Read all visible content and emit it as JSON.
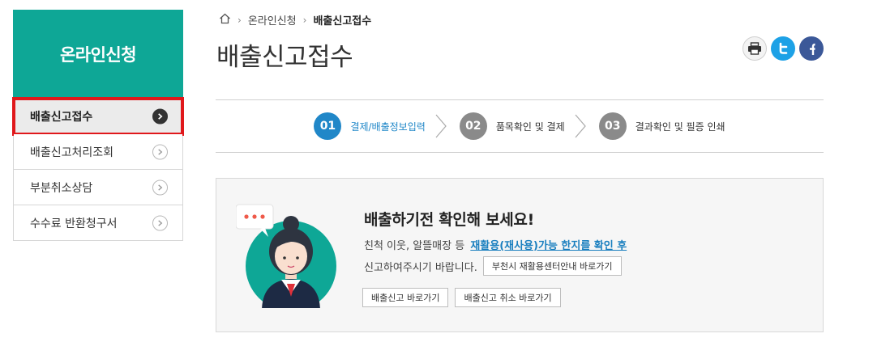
{
  "sidebar": {
    "title": "온라인신청",
    "items": [
      {
        "label": "배출신고접수",
        "active": true
      },
      {
        "label": "배출신고처리조회",
        "active": false
      },
      {
        "label": "부분취소상담",
        "active": false
      },
      {
        "label": "수수료 반환청구서",
        "active": false
      }
    ]
  },
  "breadcrumb": {
    "icon": "home-icon",
    "items": [
      "온라인신청",
      "배출신고접수"
    ]
  },
  "page": {
    "title": "배출신고접수"
  },
  "share": {
    "icons": [
      "print-icon",
      "twitter-icon",
      "facebook-icon"
    ]
  },
  "steps": [
    {
      "num": "01",
      "label": "결제/배출정보입력",
      "active": true
    },
    {
      "num": "02",
      "label": "품목확인 및 결제",
      "active": false
    },
    {
      "num": "03",
      "label": "결과확인 및 필증 인쇄",
      "active": false
    }
  ],
  "notice": {
    "title": "배출하기전 확인해 보세요!",
    "line1_text": "친척 이웃, 알뜰매장 등",
    "line1_link": "재활용(재사용)가능 한지를 확인 후",
    "line2_text": "신고하여주시기 바랍니다.",
    "center_button": "부천시 재활용센터안내 바로가기",
    "report_button": "배출신고 바로가기",
    "cancel_button": "배출신고 취소 바로가기"
  },
  "colors": {
    "brand": "#0ea796",
    "accent": "#2087c8",
    "highlight": "#e0181b",
    "link": "#1a7fbf"
  }
}
